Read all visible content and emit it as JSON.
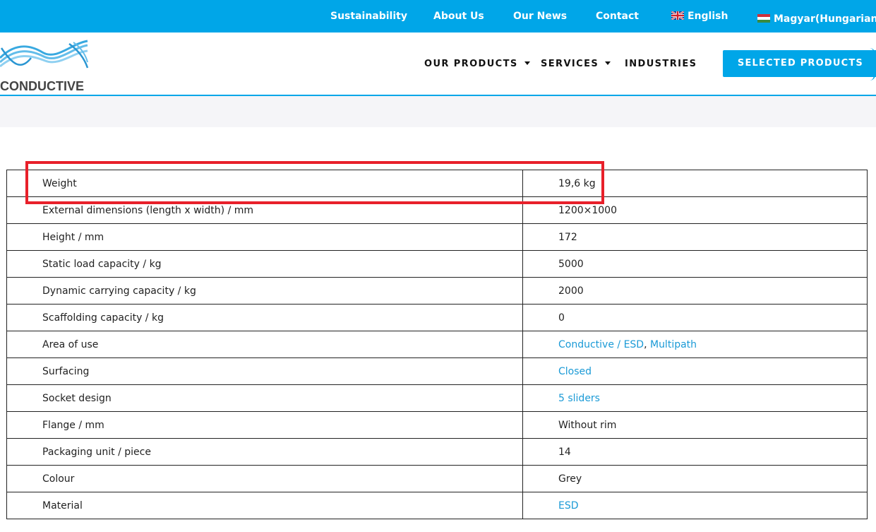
{
  "topbar": {
    "links": [
      "Sustainability",
      "About Us",
      "Our News",
      "Contact"
    ],
    "lang_en": "English",
    "lang_hu": "Magyar(Hungarian",
    "lang_hu_sup": "IF"
  },
  "header": {
    "logo_text": "CONDUCTIVE",
    "nav": {
      "products": "OUR PRODUCTS",
      "services": "SERVICES",
      "industries": "INDUSTRIES"
    },
    "selected_products": "SELECTED PRODUCTS"
  },
  "specs": [
    {
      "label": "Weight",
      "value": "19,6 kg"
    },
    {
      "label": "External dimensions (length x width) / mm",
      "value": "1200×1000"
    },
    {
      "label": "Height / mm",
      "value": "172"
    },
    {
      "label": "Static load capacity / kg",
      "value": "5000"
    },
    {
      "label": "Dynamic carrying capacity / kg",
      "value": "2000"
    },
    {
      "label": "Scaffolding capacity / kg",
      "value": "0"
    },
    {
      "label": "Area of use",
      "value_link1": "Conductive / ESD",
      "value_sep": ", ",
      "value_link2": "Multipath"
    },
    {
      "label": "Surfacing",
      "value_link": "Closed"
    },
    {
      "label": "Socket design",
      "value_link": "5 sliders"
    },
    {
      "label": "Flange / mm",
      "value": "Without rim"
    },
    {
      "label": "Packaging unit / piece",
      "value": "14"
    },
    {
      "label": "Colour",
      "value": "Grey"
    },
    {
      "label": "Material",
      "value_link": "ESD"
    }
  ],
  "colors": {
    "brand": "#00a6e8",
    "link": "#1a9ad6",
    "highlight": "#e8202a"
  }
}
